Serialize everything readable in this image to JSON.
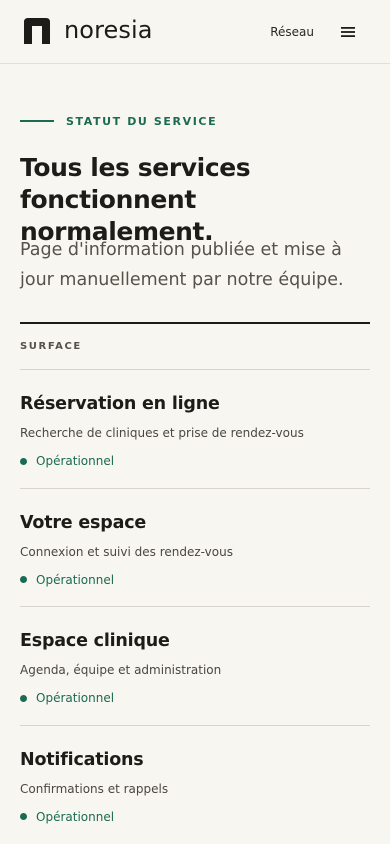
{
  "header": {
    "logo_text": "noresia",
    "nav_link": "Réseau",
    "menu_icon": "hamburger-menu-icon",
    "logo_icon": "noresia-logo-icon"
  },
  "hero": {
    "eyebrow": "STATUT DU SERVICE",
    "title": "Tous les services fonctionnent normalement.",
    "subtitle": "Page d'information publiée et mise à jour manuellement par notre équipe."
  },
  "surface": {
    "label": "SURFACE",
    "services": [
      {
        "name": "Réservation en ligne",
        "description": "Recherche de cliniques et prise de rendez-vous",
        "status": "Opérationnel"
      },
      {
        "name": "Votre espace",
        "description": "Connexion et suivi des rendez-vous",
        "status": "Opérationnel"
      },
      {
        "name": "Espace clinique",
        "description": "Agenda, équipe et administration",
        "status": "Opérationnel"
      },
      {
        "name": "Notifications",
        "description": "Confirmations et rappels",
        "status": "Opérationnel"
      }
    ]
  },
  "colors": {
    "background": "#f8f6f0",
    "accent_green": "#1a6b52",
    "text_dark": "#1e1c19"
  }
}
